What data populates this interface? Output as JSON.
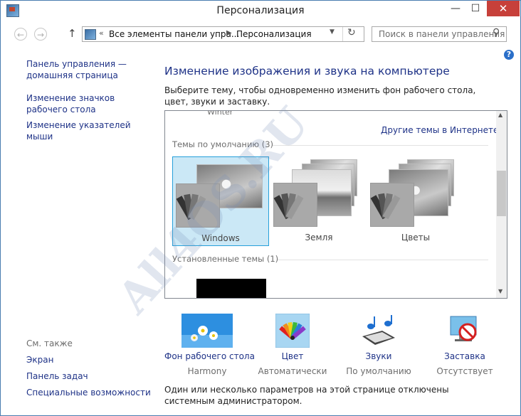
{
  "window": {
    "title": "Персонализация",
    "controls": {
      "minimize": "—",
      "maximize": "☐",
      "close": "✕"
    }
  },
  "navbar": {
    "back": "←",
    "forward": "→",
    "up": "↑",
    "address": {
      "chevron": "«",
      "parent": "Все элементы панели упра...",
      "separator": "▶",
      "current": "Персонализация",
      "dropdown": "▼",
      "refresh": "↻"
    },
    "search_placeholder": "Поиск в панели управления"
  },
  "help": "?",
  "sidebar": {
    "links": [
      "Панель управления — домашняя страница",
      "Изменение значков рабочего стола",
      "Изменение указателей мыши"
    ],
    "see_also_title": "См. также",
    "see_also": [
      "Экран",
      "Панель задач",
      "Специальные возможности"
    ]
  },
  "main": {
    "title": "Изменение изображения и звука на компьютере",
    "subtitle": "Выберите тему, чтобы одновременно изменить фон рабочего стола, цвет, звуки и заставку.",
    "themes": {
      "cut_label": "Winter",
      "online_link": "Другие темы в Интернете",
      "default_section": "Темы по умолчанию (3)",
      "installed_section": "Установленные темы (1)",
      "items": [
        {
          "name": "Windows",
          "selected": true
        },
        {
          "name": "Земля",
          "selected": false
        },
        {
          "name": "Цветы",
          "selected": false
        }
      ]
    },
    "options": [
      {
        "label": "Фон рабочего стола",
        "value": "Harmony",
        "icon": "wallpaper-icon"
      },
      {
        "label": "Цвет",
        "value": "Автоматически",
        "icon": "color-palette-icon"
      },
      {
        "label": "Звуки",
        "value": "По умолчанию",
        "icon": "music-notes-icon"
      },
      {
        "label": "Заставка",
        "value": "Отсутствует",
        "icon": "screensaver-none-icon"
      }
    ],
    "notice": "Один или несколько параметров на этой странице отключены системным администратором."
  },
  "watermark": "All4OS.RU",
  "colors": {
    "link": "#1e3287",
    "selected_bg": "#cbe8f6",
    "selected_border": "#26a0da",
    "close_btn": "#c7403a"
  }
}
